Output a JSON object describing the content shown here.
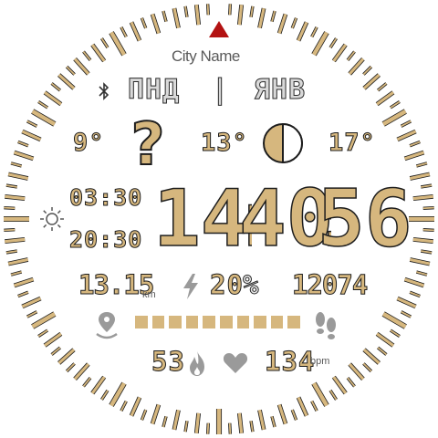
{
  "city": "City Name",
  "day_of_week": "ПНД",
  "separator": "|",
  "month": "ЯНВ",
  "weather": {
    "temp_low": "9°",
    "temp_now": "13°",
    "temp_high": "17°"
  },
  "sun": {
    "sunrise": "03:30",
    "sunset": "20:30"
  },
  "time": {
    "hours": "14",
    "minutes": "40",
    "seconds": "56",
    "colon": ":"
  },
  "distance": {
    "value": "13.15",
    "unit": "km"
  },
  "battery": {
    "value": "20",
    "unit": "%"
  },
  "steps": {
    "value": "12074",
    "progress_filled": 10,
    "progress_total": 10
  },
  "calories": "53",
  "heart_rate": {
    "value": "134",
    "unit": "bpm"
  },
  "colors": {
    "accent": "#d6b77e",
    "outline": "#1d1d1d",
    "north_marker": "#b31212",
    "icon_gray": "#9a9a9a"
  }
}
